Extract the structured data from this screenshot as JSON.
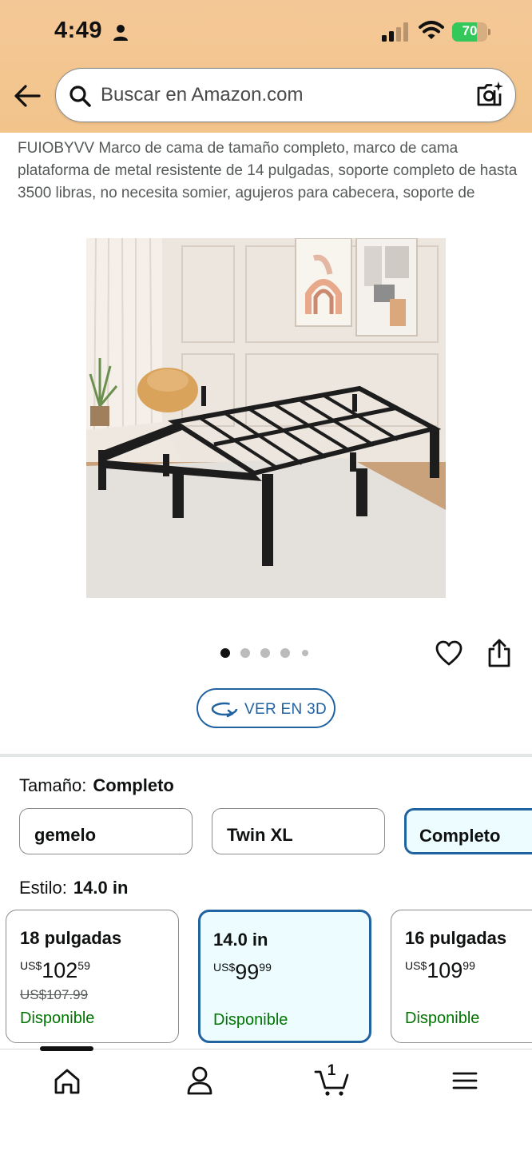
{
  "status_bar": {
    "time": "4:49",
    "battery_level": "70",
    "battery_fraction": 0.7,
    "battery_color": "#34c759"
  },
  "search": {
    "placeholder": "Buscar en Amazon.com"
  },
  "product": {
    "title": "FUIOBYVV Marco de cama de tamaño completo, marco de cama plataforma de metal resistente de 14 pulgadas, soporte completo de hasta 3500 libras, no necesita somier, agujeros para cabecera, soporte de",
    "image_alt": "Black metal platform bed frame in a bedroom",
    "gallery": {
      "count": 5,
      "active_index": 0
    },
    "view_3d_label": "VER EN 3D"
  },
  "size": {
    "label": "Tamaño:",
    "selected": "Completo",
    "options": [
      "gemelo",
      "Twin XL",
      "Completo"
    ]
  },
  "style": {
    "label": "Estilo:",
    "selected": "14.0 in",
    "options": [
      {
        "name": "18 pulgadas",
        "currency": "US$",
        "price_whole": "102",
        "price_fraction": "59",
        "was_price": "US$107.99",
        "availability": "Disponible"
      },
      {
        "name": "14.0 in",
        "currency": "US$",
        "price_whole": "99",
        "price_fraction": "99",
        "was_price": "",
        "availability": "Disponible"
      },
      {
        "name": "16 pulgadas",
        "currency": "US$",
        "price_whole": "109",
        "price_fraction": "99",
        "was_price": "",
        "availability": "Disponible"
      }
    ]
  },
  "tabbar": {
    "items": [
      "home-icon",
      "account-icon",
      "cart-icon",
      "menu-icon"
    ],
    "cart_count": "1"
  },
  "colors": {
    "header": "#f2c48c",
    "accent_blue": "#2162a1",
    "available_green": "#007600",
    "selected_bg": "#edfdff"
  }
}
